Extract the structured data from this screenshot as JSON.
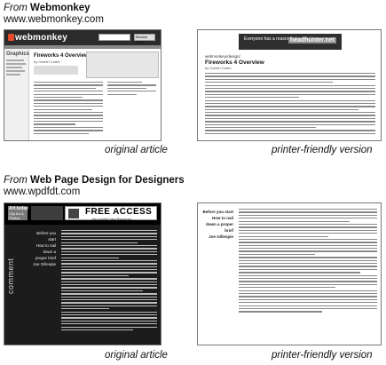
{
  "sections": [
    {
      "from_label": "From",
      "site_name": "Webmonkey",
      "url": "www.webmonkey.com",
      "original_caption": "original article",
      "printer_caption": "printer-friendly version",
      "original": {
        "logo": "webmonkey",
        "search_placeholder": "",
        "select_label": "Browse Stuff",
        "side_title": "Graphics",
        "article_title": "Fireworks 4 Overview",
        "byline": "by Gareth Carter"
      },
      "printer": {
        "banner_text": "Everyone has a reason to be a better you",
        "banner_mark": "headhunter.net",
        "path": "webmonkey/design/",
        "article_title": "Fireworks 4 Overview",
        "byline": "by Gareth Carter"
      }
    },
    {
      "from_label": "From",
      "site_name": "Web Page Design for Designers",
      "url": "www.wpdfdt.com",
      "original_caption": "original article",
      "printer_caption": "printer-friendly version",
      "original": {
        "logo_top": "Art.today",
        "logo_bottom": "Clip Art & Photos",
        "ad_title": "FREE ACCESS",
        "ad_sub": "No Credit Card Required",
        "vertical_label": "comment",
        "side_links": [
          "Before you start",
          "How to nail down a proper brief",
          "Joe Gillespie"
        ]
      },
      "printer": {
        "side_links": [
          "Before you start",
          "How to nail down a proper brief",
          "Joe Gillespie"
        ]
      }
    }
  ],
  "colors": {
    "dark_header": "#2b2b2b",
    "wd_background": "#1c1c1c",
    "border": "#777777"
  }
}
